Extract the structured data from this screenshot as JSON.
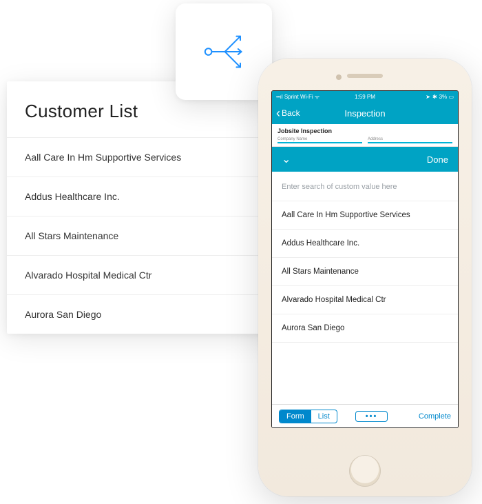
{
  "desktop": {
    "title": "Customer List",
    "rows": [
      "Aall Care In Hm Supportive Services",
      "Addus Healthcare Inc.",
      "All Stars Maintenance",
      "Alvarado Hospital Medical Ctr",
      "Aurora San Diego"
    ]
  },
  "icon_tile": {
    "name": "branch-icon"
  },
  "phone": {
    "status": {
      "carrier": "Sprint Wi-Fi",
      "time": "1:59 PM",
      "nav": "➤",
      "bt": "✱",
      "battery": "3%"
    },
    "nav": {
      "back": "Back",
      "title": "Inspection"
    },
    "form": {
      "title": "Jobsite Inspection",
      "field1": "Company Name",
      "field2": "Address"
    },
    "picker": {
      "done": "Done"
    },
    "search_placeholder": "Enter search of custom value here",
    "options": [
      "Aall Care In Hm Supportive Services",
      "Addus Healthcare Inc.",
      "All Stars Maintenance",
      "Alvarado Hospital Medical Ctr",
      "Aurora San Diego"
    ],
    "toolbar": {
      "form": "Form",
      "list": "List",
      "more": "•••",
      "complete": "Complete"
    }
  }
}
